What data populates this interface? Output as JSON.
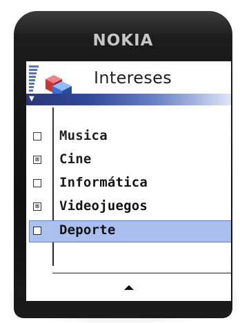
{
  "device": {
    "brand": "NOKIA"
  },
  "header": {
    "title": "Intereses",
    "icon": "cubes-icon",
    "signal_icon": "signal-strength-icon"
  },
  "list": {
    "items": [
      {
        "label": "Musica",
        "checked": false
      },
      {
        "label": "Cine",
        "checked": true
      },
      {
        "label": "Informática",
        "checked": false
      },
      {
        "label": "Videojuegos",
        "checked": true
      },
      {
        "label": "Deporte",
        "checked": false,
        "selected": true
      }
    ]
  },
  "softkeys": {
    "center_icon": "up-arrow-icon"
  },
  "colors": {
    "title_band_dark": "#0c1b66",
    "selection": "#a9c0ee",
    "phone_body": "#101010"
  }
}
